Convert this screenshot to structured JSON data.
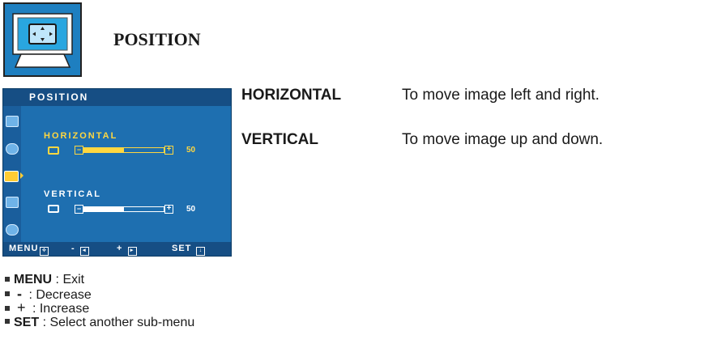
{
  "header": {
    "title": "POSITION",
    "icon": "monitor-position-icon"
  },
  "osd": {
    "title": "POSITION",
    "sidebar_icons": [
      "picture-icon",
      "color-icon",
      "position-icon",
      "tracking-icon",
      "setup-icon"
    ],
    "active_sidebar_index": 2,
    "controls": [
      {
        "label": "HORIZONTAL",
        "value": "50",
        "fill_percent": 50,
        "highlight": true
      },
      {
        "label": "VERTICAL",
        "value": "50",
        "fill_percent": 50,
        "highlight": false
      }
    ],
    "footer": {
      "menu": "MENU",
      "minus": "-",
      "plus": "+",
      "set": "SET"
    },
    "colors": {
      "panel": "#1e6fb0",
      "bar": "#164e84",
      "highlight": "#ffd740"
    }
  },
  "descriptions": [
    {
      "term": "HORIZONTAL",
      "text": "To move image left and right."
    },
    {
      "term": "VERTICAL",
      "text": "To move image up and down."
    }
  ],
  "legend": [
    {
      "key": "MENU",
      "text": " : Exit"
    },
    {
      "key": "-",
      "text": " : Decrease"
    },
    {
      "key": "+",
      "text": " : Increase"
    },
    {
      "key": "SET",
      "text": " : Select another sub-menu"
    }
  ]
}
